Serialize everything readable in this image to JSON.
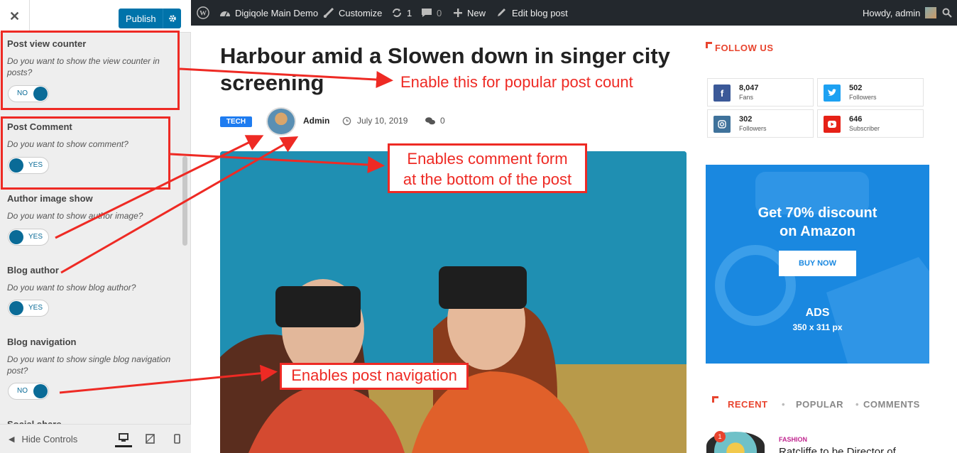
{
  "customizer": {
    "close_icon": "close-icon",
    "publish_label": "Publish",
    "options": [
      {
        "title": "Post view counter",
        "desc": "Do you want to show the view counter in posts?",
        "toggle": "NO"
      },
      {
        "title": "Post Comment",
        "desc": "Do you want to show comment?",
        "toggle": "YES"
      },
      {
        "title": "Author image show",
        "desc": "Do you want to show author image?",
        "toggle": "YES"
      },
      {
        "title": "Blog author",
        "desc": "Do you want to show blog author?",
        "toggle": "YES"
      },
      {
        "title": "Blog navigation",
        "desc": "Do you want to show single blog navigation post?",
        "toggle": "NO"
      },
      {
        "title": "Social share"
      }
    ],
    "hide_controls_label": "Hide Controls",
    "devices": [
      "desktop-icon",
      "tablet-icon",
      "mobile-icon"
    ]
  },
  "adminbar": {
    "site_name": "Digiqole Main Demo",
    "customize": "Customize",
    "updates": "1",
    "comments": "0",
    "new": "New",
    "edit": "Edit blog post",
    "howdy": "Howdy, admin"
  },
  "post": {
    "title": "Harbour amid a Slowen down in singer city screening",
    "category": "TECH",
    "author": "Admin",
    "date": "July 10, 2019",
    "comment_count": "0"
  },
  "follow": {
    "title": "FOLLOW US",
    "items": [
      {
        "count": "8,047",
        "label": "Fans",
        "color": "#3b5998",
        "icon": "facebook-icon"
      },
      {
        "count": "502",
        "label": "Followers",
        "color": "#1da1f2",
        "icon": "twitter-icon"
      },
      {
        "count": "302",
        "label": "Followers",
        "color": "#3f729b",
        "icon": "instagram-icon"
      },
      {
        "count": "646",
        "label": "Subscriber",
        "color": "#e62117",
        "icon": "youtube-icon"
      }
    ]
  },
  "ad": {
    "headline_1": "Get 70% discount",
    "headline_2": "on Amazon",
    "button": "BUY NOW",
    "ads": "ADS",
    "size": "350 x 311 px"
  },
  "tabs": {
    "recent": "RECENT",
    "popular": "POPULAR",
    "comments": "COMMENTS"
  },
  "recent_post": {
    "num": "1",
    "category": "FASHION",
    "title": "Ratcliffe to be Director of"
  },
  "annotations": {
    "counter": "Enable this for popular post count",
    "comment_1": "Enables comment form",
    "comment_2": "at the bottom of the post",
    "navigation": "Enables post navigation"
  },
  "colors": {
    "accent": "#e8442e",
    "annotation": "#ee2a24",
    "wp_blue": "#0073aa"
  }
}
